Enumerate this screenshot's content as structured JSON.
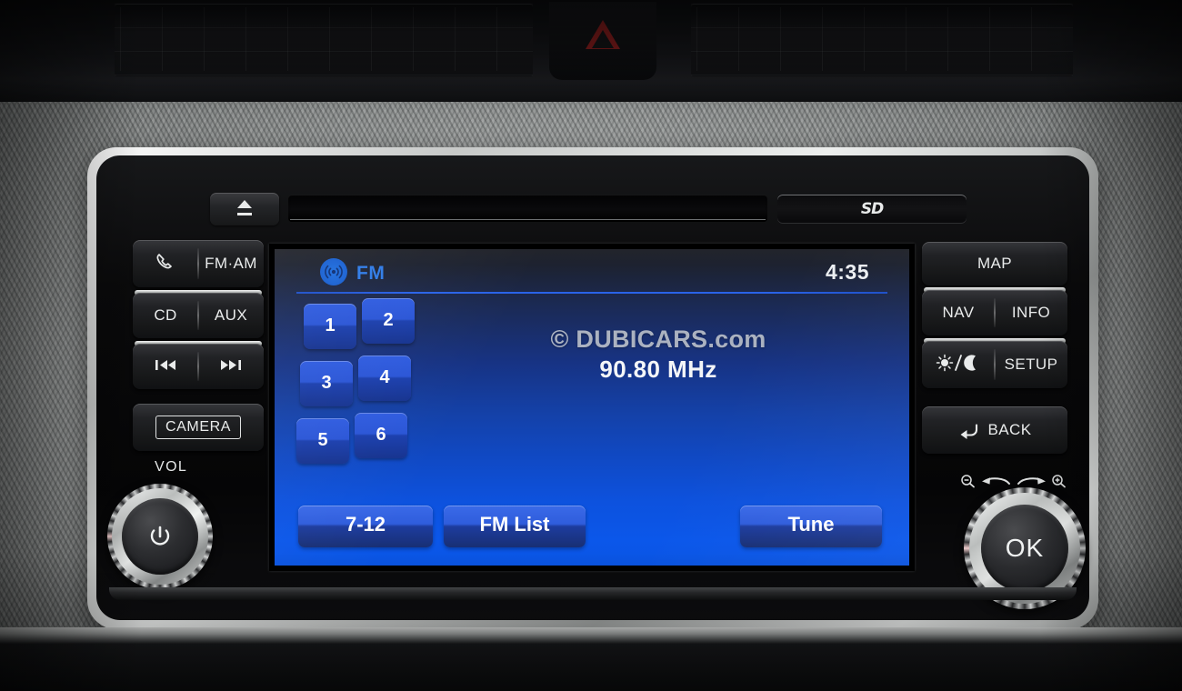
{
  "device": {
    "name": "car-infotainment-head-unit",
    "top_strip": {
      "eject_icon": "eject-icon",
      "cd_slot": "cd-slot",
      "sd_slot_label": "SD"
    }
  },
  "left_panel": {
    "buttons": [
      {
        "id": "phone",
        "icon": "phone-icon",
        "label": ""
      },
      {
        "id": "fm-am",
        "label": "FM·AM"
      },
      {
        "id": "cd",
        "label": "CD"
      },
      {
        "id": "aux",
        "label": "AUX"
      },
      {
        "id": "prev-track",
        "label": "◂◂"
      },
      {
        "id": "next-track",
        "label": "▸▸"
      },
      {
        "id": "camera",
        "label": "CAMERA"
      }
    ],
    "volume_knob": {
      "label": "VOL",
      "icon": "power-icon"
    }
  },
  "right_panel": {
    "buttons": [
      {
        "id": "map",
        "label": "MAP"
      },
      {
        "id": "nav",
        "label": "NAV"
      },
      {
        "id": "info",
        "label": "INFO"
      },
      {
        "id": "day-night",
        "label": "",
        "icon": "sun-moon-icon"
      },
      {
        "id": "setup",
        "label": "SETUP"
      },
      {
        "id": "back",
        "label": "BACK",
        "icon": "back-arrow-icon"
      }
    ],
    "ok_knob": {
      "label": "OK",
      "zoom_out_icon": "zoom-out-icon",
      "zoom_in_icon": "zoom-in-icon"
    }
  },
  "screen": {
    "source_icon": "radio-wave-icon",
    "source_label": "FM",
    "clock": "4:35",
    "presets": [
      "1",
      "2",
      "3",
      "4",
      "5",
      "6"
    ],
    "watermark": "© DUBICARS.com",
    "frequency": "90.80 MHz",
    "bottom_buttons": [
      {
        "id": "preset-bank",
        "label": "7-12"
      },
      {
        "id": "fm-list",
        "label": "FM List"
      },
      {
        "id": "tune",
        "label": "Tune"
      }
    ],
    "colors": {
      "accent_blue": "#2f7ce8",
      "screen_top": "#22242b",
      "screen_bottom": "#0a55e4",
      "button_blue": "#2f5ce0",
      "text_white": "#f4f6f8"
    }
  },
  "dashboard": {
    "hazard_button": "hazard-warning-icon",
    "vents": [
      "air-vent-left",
      "air-vent-right"
    ]
  }
}
